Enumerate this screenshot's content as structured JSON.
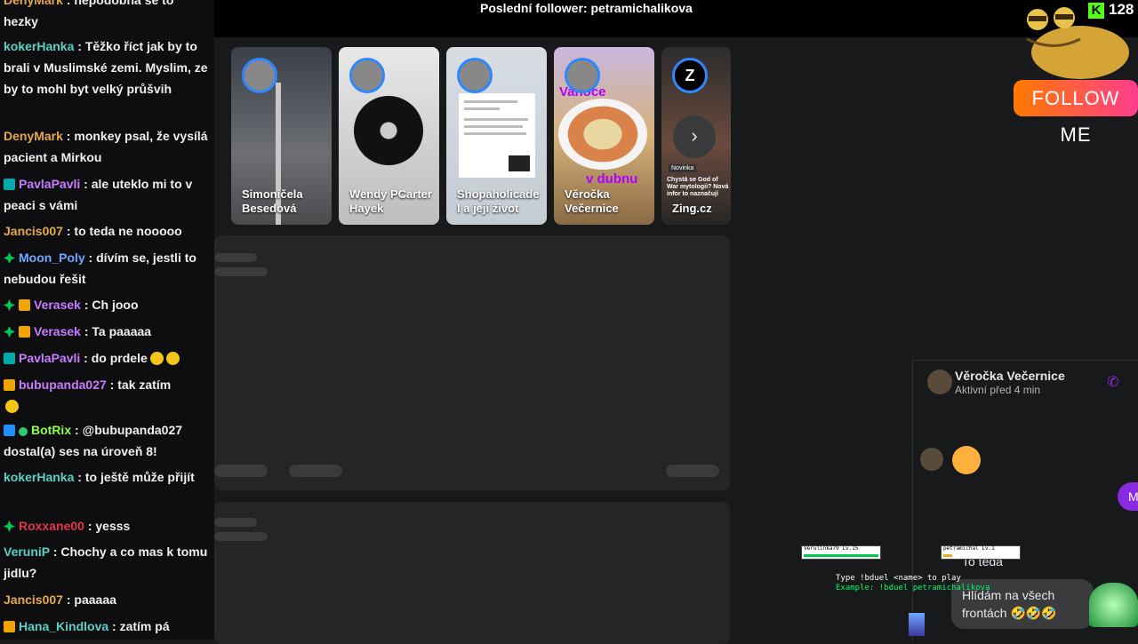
{
  "topbar": {
    "last_follower": "Poslední follower: petramichalikova"
  },
  "kick": {
    "icon_letter": "K",
    "viewer_count": "128"
  },
  "follow_button": {
    "label": "FOLLOW ME"
  },
  "stories": [
    {
      "name": "Simoničela Besedová"
    },
    {
      "name": "Wendy PCarter Hayek"
    },
    {
      "name": "Shopaholicade l a její život"
    },
    {
      "name": "Věročka Večernice",
      "overlay_top": "Vanoce",
      "overlay_bottom": "v dubnu"
    },
    {
      "name": "Zing.cz",
      "badge": "Novinka",
      "teaser": "Chystá se God of War mytologii? Nová infor to naznačují",
      "logo": "Z"
    }
  ],
  "chat": [
    {
      "user": "DenyMark",
      "text": "nepodobná se to hezky",
      "color": "#e6a84c"
    },
    {
      "user": "kokerHanka",
      "text": "Těžko říct jak by to brali v Muslimské zemi. Myslim, ze by to mohl byt velký průšvih",
      "color": "#5ad1c4"
    },
    {
      "user": "DenyMark",
      "text": "monkey psal, že vysílá pacient a Mirkou",
      "color": "#e6a84c"
    },
    {
      "user": "PavlaPavli",
      "text": "ale uteklo mi to v peaci s vámi",
      "color": "#c77dff"
    },
    {
      "user": "Jancis007",
      "text": "to teda ne nooooo",
      "color": "#e6a84c"
    },
    {
      "user": "Moon_Poly",
      "text": "dívím se, jestli to nebudou řešit",
      "color": "#6fa8ff"
    },
    {
      "user": "Verasek",
      "text": "Ch jooo",
      "color": "#c77dff"
    },
    {
      "user": "Verasek",
      "text": "Ta paaaaa",
      "color": "#c77dff"
    },
    {
      "user": "PavlaPavli",
      "text": "do prdele",
      "color": "#c77dff"
    },
    {
      "user": "bubupanda027",
      "text": "tak zatím",
      "color": "#c77dff"
    },
    {
      "user": "BotRix",
      "text": "@bubupanda027 dostal(a) ses na úroveň 8!",
      "color": "#8bff4d",
      "mention_color": "#8fb4ff"
    },
    {
      "user": "kokerHanka",
      "text": "to ještě může přijít",
      "color": "#5ad1c4"
    },
    {
      "user": "Roxxane00",
      "text": "yesss",
      "color": "#e0364b"
    },
    {
      "user": "VeruniP",
      "text": "Chochy a co mas k tomu jidlu?",
      "color": "#5ad1c4"
    },
    {
      "user": "Jancis007",
      "text": "paaaaa",
      "color": "#e6a84c"
    },
    {
      "user": "Hana_Kindlova",
      "text": "zatím pá",
      "color": "#5ad1c4"
    }
  ],
  "messenger": {
    "contact_name": "Věročka Večernice",
    "status": "Aktivní před 4 min",
    "outgoing_initial": "M",
    "msg_to_teda": "To teda",
    "msg_hlidam": "Hlídám na všech frontách 🤣🤣🤣"
  },
  "game": {
    "player1": "Verulinka79 Lv.15",
    "player2": "petramichal Lv.1",
    "duel_hint": "Type !bduel <name> to play",
    "duel_example": "Example: !bduel petramichalikova"
  }
}
